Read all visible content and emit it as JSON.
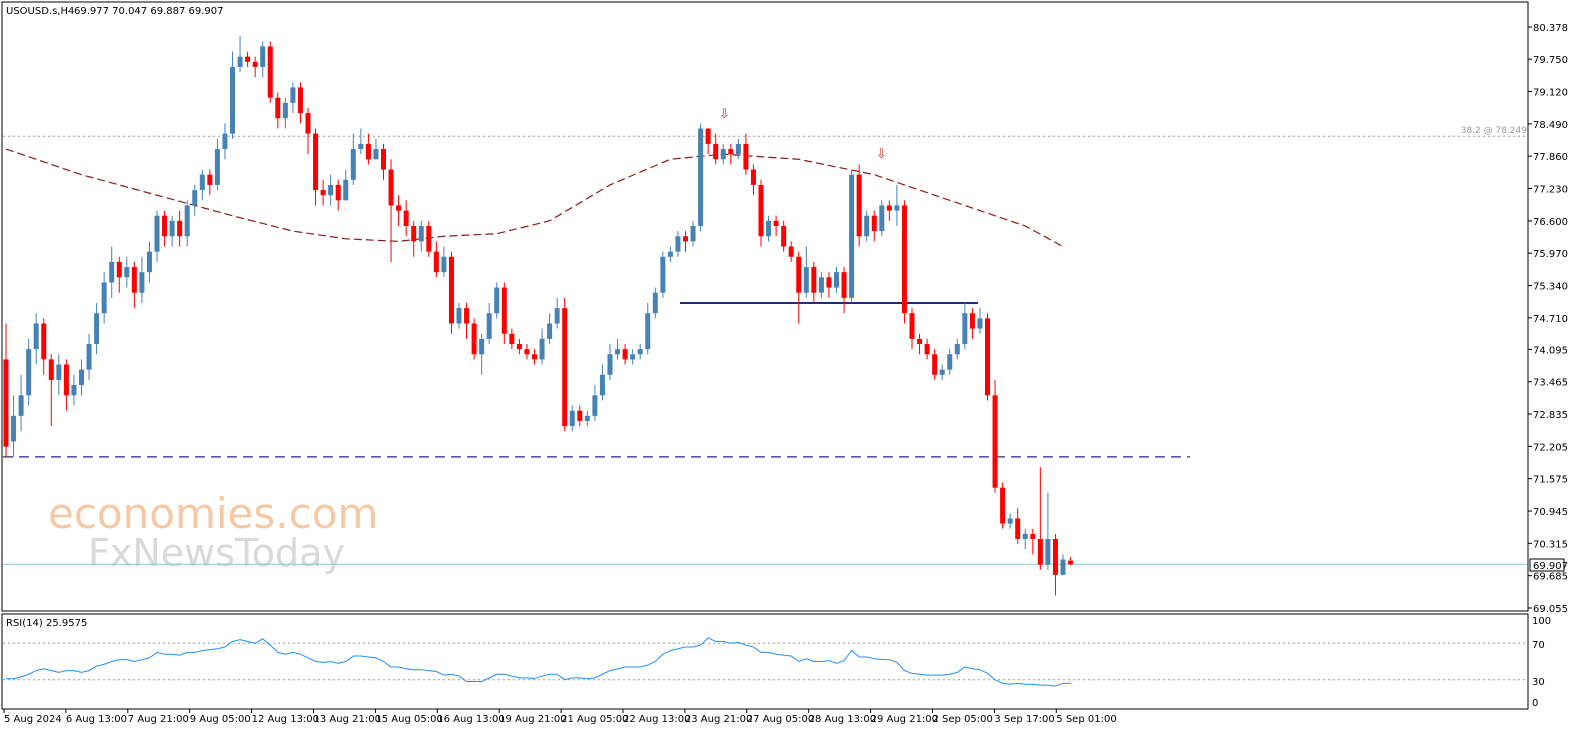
{
  "header": {
    "symbol": "USOUSD.s,H4",
    "ohlc": "69.977 70.047 69.887 69.907"
  },
  "watermark": {
    "line1": "economies.com",
    "line2": "FxNewsToday"
  },
  "rsi": {
    "label": "RSI(14) 25.9575",
    "levels": [
      70,
      30
    ],
    "ticks": [
      "100",
      "70",
      "30",
      "0"
    ]
  },
  "fibo_label": "38.2 @ 78.249",
  "current_price": "69.907",
  "colors": {
    "bull": "#4682b4",
    "bear": "#ff0000",
    "ma": "#8b1a1a",
    "rsi": "#1e90ff",
    "support": "#1f2a80",
    "neckline": "#1f2a80",
    "price_line": "#7fd0d0"
  },
  "chart_data": {
    "type": "candlestick",
    "title": "USOUSD.s,H4",
    "price_axis": {
      "min": 69.055,
      "max": 80.378,
      "ticks": [
        "80.378",
        "79.750",
        "79.120",
        "78.490",
        "77.860",
        "77.230",
        "76.600",
        "75.970",
        "75.340",
        "74.710",
        "74.095",
        "73.465",
        "72.835",
        "72.205",
        "71.575",
        "70.945",
        "70.315",
        "69.685",
        "69.055"
      ]
    },
    "time_labels": [
      "5 Aug 2024",
      "6 Aug 13:00",
      "7 Aug 21:00",
      "9 Aug 05:00",
      "12 Aug 13:00",
      "13 Aug 21:00",
      "15 Aug 05:00",
      "16 Aug 13:00",
      "19 Aug 21:00",
      "21 Aug 05:00",
      "22 Aug 13:00",
      "23 Aug 21:00",
      "27 Aug 05:00",
      "28 Aug 13:00",
      "29 Aug 21:00",
      "2 Sep 05:00",
      "3 Sep 17:00",
      "5 Sep 01:00"
    ],
    "levels": [
      {
        "name": "38.2 @ 78.249",
        "value": 78.249,
        "style": "dotted"
      },
      {
        "name": "support",
        "value": 72.0,
        "style": "dashed"
      },
      {
        "name": "neckline",
        "value": 75.0,
        "style": "solid"
      },
      {
        "name": "current",
        "value": 69.907,
        "style": "solid"
      }
    ],
    "candles": [
      [
        73.9,
        72.2,
        74.6,
        72.0
      ],
      [
        72.3,
        72.8,
        73.2,
        72.0
      ],
      [
        72.8,
        73.2,
        73.6,
        72.5
      ],
      [
        73.2,
        74.1,
        74.3,
        73.0
      ],
      [
        74.1,
        74.6,
        74.8,
        73.8
      ],
      [
        74.6,
        73.9,
        74.7,
        73.6
      ],
      [
        73.9,
        73.5,
        74.0,
        72.6
      ],
      [
        73.5,
        73.8,
        74.0,
        73.2
      ],
      [
        73.8,
        73.2,
        73.9,
        72.9
      ],
      [
        73.2,
        73.4,
        73.6,
        73.0
      ],
      [
        73.4,
        73.7,
        73.9,
        73.2
      ],
      [
        73.7,
        74.2,
        74.4,
        73.5
      ],
      [
        74.2,
        74.8,
        75.0,
        74.0
      ],
      [
        74.8,
        75.4,
        75.6,
        74.6
      ],
      [
        75.4,
        75.8,
        76.1,
        75.1
      ],
      [
        75.8,
        75.5,
        75.9,
        75.2
      ],
      [
        75.5,
        75.7,
        75.9,
        75.3
      ],
      [
        75.7,
        75.2,
        75.8,
        74.9
      ],
      [
        75.2,
        75.6,
        75.9,
        75.0
      ],
      [
        75.6,
        76.0,
        76.2,
        75.4
      ],
      [
        76.0,
        76.7,
        76.8,
        75.8
      ],
      [
        76.7,
        76.3,
        76.8,
        76.1
      ],
      [
        76.3,
        76.6,
        76.7,
        76.1
      ],
      [
        76.6,
        76.3,
        76.8,
        76.1
      ],
      [
        76.3,
        76.9,
        77.0,
        76.1
      ],
      [
        76.9,
        77.2,
        77.3,
        76.7
      ],
      [
        77.2,
        77.5,
        77.6,
        77.0
      ],
      [
        77.5,
        77.3,
        77.6,
        77.1
      ],
      [
        77.3,
        78.0,
        78.2,
        77.2
      ],
      [
        78.0,
        78.3,
        78.5,
        77.8
      ],
      [
        78.3,
        79.6,
        79.9,
        78.2
      ],
      [
        79.6,
        79.8,
        80.2,
        79.5
      ],
      [
        79.8,
        79.7,
        79.9,
        79.6
      ],
      [
        79.7,
        79.6,
        79.8,
        79.4
      ],
      [
        79.6,
        80.0,
        80.1,
        79.4
      ],
      [
        80.0,
        79.0,
        80.1,
        78.9
      ],
      [
        79.0,
        78.6,
        79.1,
        78.4
      ],
      [
        78.6,
        78.9,
        79.0,
        78.4
      ],
      [
        78.9,
        79.2,
        79.3,
        78.7
      ],
      [
        79.2,
        78.7,
        79.3,
        78.5
      ],
      [
        78.7,
        78.3,
        78.8,
        77.9
      ],
      [
        78.3,
        77.2,
        78.4,
        76.9
      ],
      [
        77.2,
        77.1,
        77.4,
        76.9
      ],
      [
        77.1,
        77.3,
        77.5,
        76.9
      ],
      [
        77.3,
        77.0,
        77.4,
        76.8
      ],
      [
        77.0,
        77.4,
        77.6,
        77.0
      ],
      [
        77.4,
        78.0,
        78.3,
        77.3
      ],
      [
        78.0,
        78.1,
        78.4,
        77.9
      ],
      [
        78.1,
        77.8,
        78.3,
        77.7
      ],
      [
        77.8,
        78.0,
        78.2,
        77.8
      ],
      [
        78.0,
        77.6,
        78.1,
        77.4
      ],
      [
        77.6,
        76.9,
        77.8,
        75.8
      ],
      [
        76.9,
        76.8,
        77.1,
        76.5
      ],
      [
        76.8,
        76.5,
        77.0,
        76.3
      ],
      [
        76.5,
        76.2,
        76.6,
        75.9
      ],
      [
        76.2,
        76.5,
        76.6,
        76.0
      ],
      [
        76.5,
        76.0,
        76.6,
        75.9
      ],
      [
        76.0,
        75.6,
        76.2,
        75.5
      ],
      [
        75.6,
        75.9,
        76.1,
        75.5
      ],
      [
        75.9,
        74.6,
        76.0,
        74.4
      ],
      [
        74.6,
        74.9,
        75.0,
        74.5
      ],
      [
        74.9,
        74.6,
        75.0,
        74.3
      ],
      [
        74.6,
        74.0,
        74.7,
        73.9
      ],
      [
        74.0,
        74.3,
        74.4,
        73.6
      ],
      [
        74.3,
        74.8,
        75.0,
        74.2
      ],
      [
        74.8,
        75.3,
        75.4,
        74.7
      ],
      [
        75.3,
        74.4,
        75.4,
        74.2
      ],
      [
        74.4,
        74.2,
        74.5,
        74.1
      ],
      [
        74.2,
        74.1,
        74.3,
        74.0
      ],
      [
        74.1,
        74.0,
        74.2,
        73.9
      ],
      [
        74.0,
        73.9,
        74.1,
        73.8
      ],
      [
        73.9,
        74.3,
        74.5,
        73.8
      ],
      [
        74.3,
        74.6,
        74.8,
        74.2
      ],
      [
        74.6,
        74.9,
        75.1,
        74.5
      ],
      [
        74.9,
        72.6,
        75.1,
        72.5
      ],
      [
        72.6,
        72.9,
        73.0,
        72.5
      ],
      [
        72.9,
        72.7,
        73.0,
        72.6
      ],
      [
        72.7,
        72.8,
        72.9,
        72.6
      ],
      [
        72.8,
        73.2,
        73.4,
        72.7
      ],
      [
        73.2,
        73.6,
        73.8,
        73.1
      ],
      [
        73.6,
        74.0,
        74.2,
        73.5
      ],
      [
        74.0,
        74.1,
        74.3,
        73.9
      ],
      [
        74.1,
        73.9,
        74.2,
        73.8
      ],
      [
        73.9,
        74.0,
        74.1,
        73.8
      ],
      [
        74.0,
        74.1,
        74.2,
        73.9
      ],
      [
        74.1,
        74.8,
        75.0,
        74.0
      ],
      [
        74.8,
        75.2,
        75.3,
        74.7
      ],
      [
        75.2,
        75.9,
        76.0,
        75.1
      ],
      [
        75.9,
        76.0,
        76.1,
        75.8
      ],
      [
        76.0,
        76.3,
        76.4,
        75.9
      ],
      [
        76.3,
        76.2,
        76.4,
        76.0
      ],
      [
        76.2,
        76.5,
        76.6,
        76.1
      ],
      [
        76.5,
        78.4,
        78.5,
        76.4
      ],
      [
        78.4,
        78.1,
        78.4,
        77.9
      ],
      [
        78.1,
        77.8,
        78.3,
        77.7
      ],
      [
        77.8,
        78.0,
        78.1,
        77.7
      ],
      [
        78.0,
        77.9,
        78.1,
        77.7
      ],
      [
        77.9,
        78.1,
        78.2,
        77.8
      ],
      [
        78.1,
        77.6,
        78.3,
        77.5
      ],
      [
        77.6,
        77.3,
        77.7,
        77.1
      ],
      [
        77.3,
        76.3,
        77.4,
        76.1
      ],
      [
        76.3,
        76.6,
        76.7,
        76.2
      ],
      [
        76.6,
        76.5,
        76.7,
        76.3
      ],
      [
        76.5,
        76.1,
        76.6,
        76.0
      ],
      [
        76.1,
        75.9,
        76.2,
        75.8
      ],
      [
        75.9,
        75.2,
        76.0,
        74.6
      ],
      [
        75.2,
        75.7,
        76.1,
        75.1
      ],
      [
        75.7,
        75.2,
        75.8,
        75.0
      ],
      [
        75.2,
        75.5,
        75.6,
        75.1
      ],
      [
        75.5,
        75.3,
        75.6,
        75.1
      ],
      [
        75.3,
        75.6,
        75.7,
        75.2
      ],
      [
        75.6,
        75.1,
        75.7,
        74.8
      ],
      [
        75.1,
        77.5,
        77.6,
        75.0
      ],
      [
        77.5,
        76.3,
        77.7,
        76.1
      ],
      [
        76.3,
        76.7,
        76.8,
        76.2
      ],
      [
        76.7,
        76.4,
        76.8,
        76.2
      ],
      [
        76.4,
        76.9,
        77.0,
        76.3
      ],
      [
        76.9,
        76.8,
        77.0,
        76.6
      ],
      [
        76.8,
        76.9,
        77.3,
        76.5
      ],
      [
        76.9,
        74.8,
        77.0,
        74.6
      ],
      [
        74.8,
        74.3,
        74.9,
        74.1
      ],
      [
        74.3,
        74.2,
        74.4,
        74.0
      ],
      [
        74.2,
        74.0,
        74.3,
        73.9
      ],
      [
        74.0,
        73.6,
        74.1,
        73.5
      ],
      [
        73.6,
        73.7,
        73.8,
        73.5
      ],
      [
        73.7,
        74.0,
        74.1,
        73.6
      ],
      [
        74.0,
        74.2,
        74.3,
        73.9
      ],
      [
        74.2,
        74.8,
        75.0,
        74.1
      ],
      [
        74.8,
        74.5,
        74.9,
        74.3
      ],
      [
        74.5,
        74.7,
        74.9,
        74.4
      ],
      [
        74.7,
        73.2,
        74.8,
        73.1
      ],
      [
        73.2,
        71.4,
        73.5,
        71.3
      ],
      [
        71.4,
        70.7,
        71.5,
        70.6
      ],
      [
        70.7,
        70.8,
        70.9,
        70.6
      ],
      [
        70.8,
        70.4,
        71.0,
        70.3
      ],
      [
        70.4,
        70.5,
        70.6,
        70.2
      ],
      [
        70.5,
        70.4,
        70.6,
        70.1
      ],
      [
        70.4,
        69.9,
        71.8,
        69.8
      ],
      [
        69.9,
        70.4,
        71.3,
        69.8
      ],
      [
        70.4,
        69.7,
        70.5,
        69.3
      ],
      [
        69.7,
        70.0,
        70.1,
        69.7
      ],
      [
        69.977,
        69.907,
        70.047,
        69.887
      ]
    ],
    "rsi": [
      31,
      31,
      33,
      36,
      40,
      42,
      40,
      38,
      40,
      40,
      38,
      40,
      45,
      47,
      50,
      52,
      52,
      50,
      52,
      54,
      60,
      58,
      58,
      57,
      60,
      60,
      62,
      63,
      64,
      66,
      72,
      74,
      72,
      70,
      75,
      68,
      60,
      58,
      60,
      58,
      54,
      50,
      49,
      50,
      48,
      50,
      56,
      56,
      55,
      54,
      50,
      44,
      44,
      42,
      41,
      41,
      40,
      39,
      35,
      36,
      34,
      28,
      28,
      28,
      32,
      36,
      36,
      34,
      32,
      32,
      31,
      34,
      36,
      36,
      30,
      32,
      32,
      31,
      32,
      36,
      40,
      42,
      44,
      44,
      44,
      46,
      50,
      58,
      62,
      64,
      66,
      66,
      68,
      76,
      72,
      72,
      70,
      71,
      68,
      66,
      60,
      60,
      58,
      57,
      56,
      50,
      53,
      50,
      50,
      51,
      48,
      51,
      62,
      55,
      55,
      53,
      52,
      52,
      49,
      40,
      37,
      36,
      35,
      35,
      35,
      36,
      38,
      44,
      42,
      41,
      37,
      30,
      26,
      25,
      26,
      25,
      25,
      24,
      24,
      23,
      26,
      26
    ],
    "ma_points": [
      [
        0,
        77.5
      ],
      [
        10,
        77.0
      ],
      [
        20,
        76.6
      ],
      [
        30,
        76.2
      ],
      [
        38,
        75.9
      ],
      [
        45,
        75.75
      ],
      [
        52,
        75.7
      ],
      [
        58,
        75.8
      ],
      [
        65,
        75.85
      ],
      [
        72,
        76.1
      ],
      [
        80,
        76.8
      ],
      [
        88,
        77.3
      ],
      [
        95,
        77.4
      ],
      [
        105,
        77.3
      ],
      [
        115,
        77.0
      ],
      [
        125,
        76.5
      ],
      [
        135,
        76.0
      ],
      [
        140,
        75.6
      ]
    ],
    "ma_shift": 0.5
  }
}
